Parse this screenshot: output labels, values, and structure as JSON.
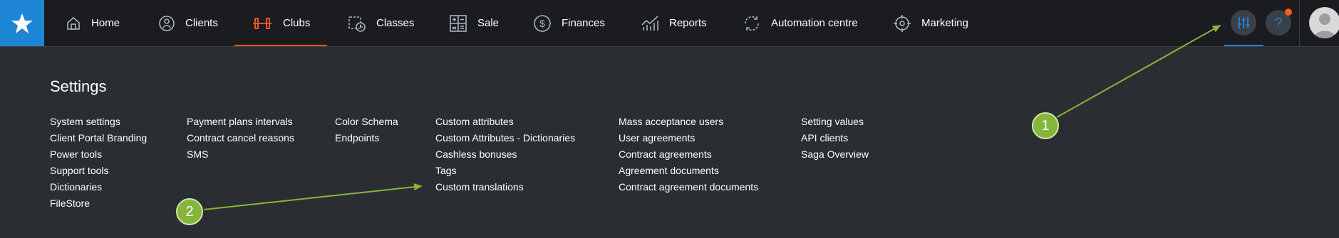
{
  "nav": {
    "items": [
      {
        "label": "Home",
        "icon": "home-icon"
      },
      {
        "label": "Clients",
        "icon": "clients-icon"
      },
      {
        "label": "Clubs",
        "icon": "dumbbell-icon"
      },
      {
        "label": "Classes",
        "icon": "calendar-clock-icon"
      },
      {
        "label": "Sale",
        "icon": "calculator-icon"
      },
      {
        "label": "Finances",
        "icon": "dollar-icon"
      },
      {
        "label": "Reports",
        "icon": "chart-icon"
      },
      {
        "label": "Automation centre",
        "icon": "sync-icon"
      },
      {
        "label": "Marketing",
        "icon": "target-icon"
      }
    ],
    "active": "Clubs",
    "help_label": "?"
  },
  "settings": {
    "title": "Settings",
    "columns": [
      [
        "System settings",
        "Client Portal Branding",
        "Power tools",
        "Support tools",
        "Dictionaries",
        "FileStore"
      ],
      [
        "Payment plans intervals",
        "Contract cancel reasons",
        "SMS"
      ],
      [
        "Color Schema",
        "Endpoints"
      ],
      [
        "Custom attributes",
        "Custom Attributes - Dictionaries",
        "Cashless bonuses",
        "Tags",
        "Custom translations"
      ],
      [
        "Mass acceptance users",
        "User agreements",
        "Contract agreements",
        "Agreement documents",
        "Contract agreement documents"
      ],
      [
        "Setting values",
        "API clients",
        "Saga Overview"
      ]
    ]
  },
  "annotations": {
    "callout_1": "1",
    "callout_2": "2"
  },
  "colors": {
    "accent_blue": "#1f86d6",
    "active_orange": "#e8542b",
    "callout_green": "#86b53c"
  }
}
